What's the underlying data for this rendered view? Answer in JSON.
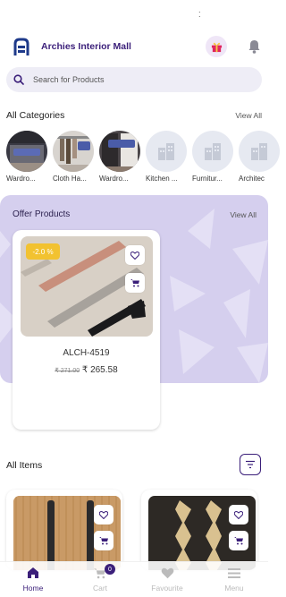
{
  "app": {
    "title": "Archies Interior Mall"
  },
  "search": {
    "placeholder": "Search for Products"
  },
  "categories_section": {
    "title": "All Categories",
    "view_all": "View All",
    "items": [
      {
        "label": "Wardro...",
        "has_image": true
      },
      {
        "label": "Cloth Ha...",
        "has_image": true
      },
      {
        "label": "Wardro...",
        "has_image": true
      },
      {
        "label": "Kitchen ...",
        "has_image": false
      },
      {
        "label": "Furnitur...",
        "has_image": false
      },
      {
        "label": "Architec",
        "has_image": false
      }
    ]
  },
  "offers_section": {
    "title": "Offer Products",
    "view_all": "View All",
    "products": [
      {
        "name": "ALCH-4519",
        "discount": "-2.0 %",
        "old_price": "₹ 271.00",
        "price": "₹ 265.58"
      }
    ]
  },
  "items_section": {
    "title": "All Items"
  },
  "bottom_nav": {
    "items": [
      {
        "label": "Home",
        "icon": "home-icon",
        "active": true
      },
      {
        "label": "Cart",
        "icon": "cart-icon",
        "active": false
      },
      {
        "label": "Favourite",
        "icon": "heart-icon",
        "active": false
      },
      {
        "label": "Menu",
        "icon": "menu-icon",
        "active": false
      }
    ],
    "cart_count": "0"
  },
  "colors": {
    "brand": "#3b1f7a",
    "offer_background": "#d5cfee",
    "badge": "#f2c230"
  }
}
